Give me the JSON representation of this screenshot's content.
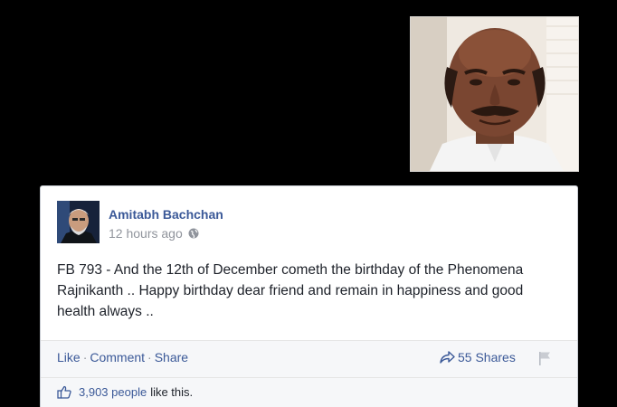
{
  "post": {
    "author": "Amitabh Bachchan",
    "time": "12 hours ago",
    "body": "FB 793 - And the 12th of December cometh the birthday of the Phenomena Rajnikanth .. Happy birthday dear friend and remain in happiness and good health always ..",
    "actions": {
      "like": "Like",
      "comment": "Comment",
      "share": "Share",
      "separator": "·"
    },
    "shares": "55 Shares",
    "likes_count": "3,903 people",
    "likes_suffix": "like this."
  },
  "icons": {
    "privacy": "globe-icon",
    "share": "share-arrow-icon",
    "report": "flag-icon",
    "like": "thumbs-up-icon"
  },
  "colors": {
    "background": "#000000",
    "link_blue": "#3b5998",
    "meta_gray": "#90949c",
    "bar_gray": "#f6f7f9"
  }
}
